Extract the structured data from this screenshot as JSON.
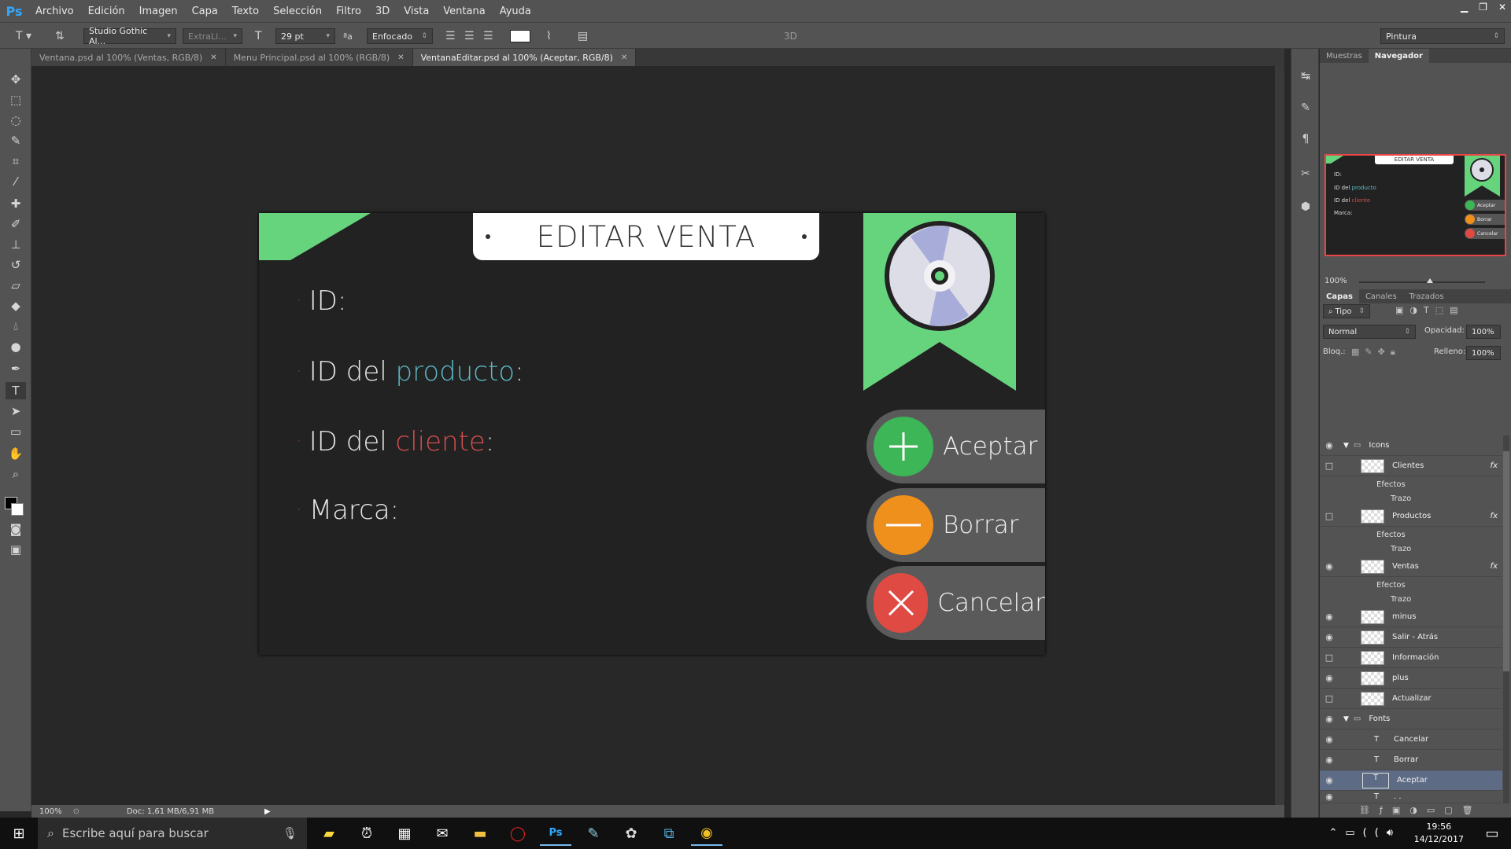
{
  "app": {
    "logo": "Ps"
  },
  "menu": [
    "Archivo",
    "Edición",
    "Imagen",
    "Capa",
    "Texto",
    "Selección",
    "Filtro",
    "3D",
    "Vista",
    "Ventana",
    "Ayuda"
  ],
  "options": {
    "font_family": "Studio Gothic Al...",
    "font_style": "ExtraLi...",
    "font_size": "29 pt",
    "antialias": "Enfocado",
    "three_d": "3D",
    "workspace": "Pintura"
  },
  "tabs": [
    {
      "label": "Ventana.psd al 100% (Ventas, RGB/8)"
    },
    {
      "label": "Menu Principal.psd al 100% (RGB/8)"
    },
    {
      "label": "VentanaEditar.psd al 100% (Aceptar, RGB/8)"
    }
  ],
  "canvas": {
    "title": "EDITAR VENTA",
    "fields": {
      "id": "ID:",
      "product_prefix": "ID del ",
      "product_word": "producto",
      "product_suffix": ":",
      "client_prefix": "ID del ",
      "client_word": "cliente",
      "client_suffix": ":",
      "brand": "Marca:"
    },
    "buttons": {
      "accept": "Aceptar",
      "delete": "Borrar",
      "cancel": "Cancelar"
    },
    "colors": {
      "green": "#66d47c",
      "accept": "#3cb656",
      "delete": "#ef8f1c",
      "cancel": "#df4a43",
      "blue_accent": "#5cb8c4",
      "red_accent": "#d44e4e"
    }
  },
  "status": {
    "zoom": "100%",
    "doc": "Doc: 1,61 MB/6,91 MB"
  },
  "navigator": {
    "tabs": [
      "Muestras",
      "Navegador"
    ],
    "zoom": "100%",
    "thumb_title": "EDITAR VENTA",
    "thumb_id": "ID:",
    "thumb_product_prefix": "ID del ",
    "thumb_product_word": "producto",
    "thumb_client_prefix": "ID del ",
    "thumb_client_word": "cliente",
    "thumb_brand": "Marca:",
    "thumb_accept": "Aceptar",
    "thumb_delete": "Borrar",
    "thumb_cancel": "Cancelar"
  },
  "layers_panel": {
    "tabs": [
      "Capas",
      "Canales",
      "Trazados"
    ],
    "filter": "Tipo",
    "blend": "Normal",
    "opacity_label": "Opacidad:",
    "opacity": "100%",
    "lock_label": "Bloq.:",
    "fill_label": "Relleno:",
    "fill": "100%",
    "layers": {
      "icons_group": "Icons",
      "clientes": "Clientes",
      "clientes_effects": "Efectos",
      "clientes_trazo": "Trazo",
      "productos": "Productos",
      "productos_effects": "Efectos",
      "productos_trazo": "Trazo",
      "ventas": "Ventas",
      "ventas_effects": "Efectos",
      "ventas_trazo": "Trazo",
      "minus": "minus",
      "salir": "Salir - Atrás",
      "informacion": "Información",
      "plus": "plus",
      "actualizar": "Actualizar",
      "fonts_group": "Fonts",
      "cancelar": "Cancelar",
      "borrar": "Borrar",
      "aceptar": "Aceptar",
      "next": ". ."
    },
    "fx": "fx"
  },
  "taskbar": {
    "search_placeholder": "Escribe aquí para buscar",
    "time": "19:56",
    "date": "14/12/2017"
  }
}
